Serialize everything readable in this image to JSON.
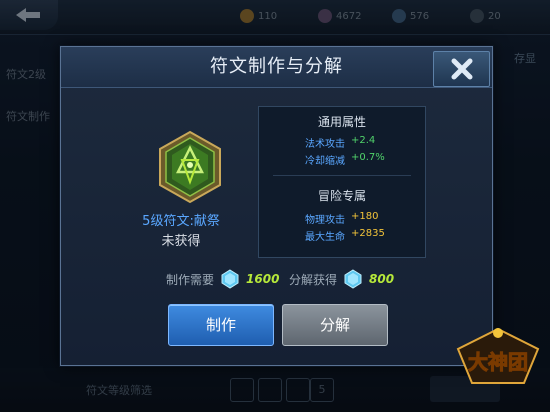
{
  "background": {
    "resources": [
      "110",
      "4672",
      "576",
      "20"
    ],
    "side_tabs": [
      "符文2级",
      "符文制作"
    ],
    "right_label": "存显",
    "bottom_filter_label": "符文等级筛选",
    "bottom_chip": "5"
  },
  "dialog": {
    "title": "符文制作与分解",
    "rune_name": "5级符文:献祭",
    "rune_status": "未获得",
    "general_attrs": {
      "title": "通用属性",
      "rows": [
        {
          "name": "法术攻击",
          "value": "+2.4"
        },
        {
          "name": "冷却缩减",
          "value": "+0.7%"
        }
      ]
    },
    "adventure_attrs": {
      "title": "冒险专属",
      "rows": [
        {
          "name": "物理攻击",
          "value": "+180"
        },
        {
          "name": "最大生命",
          "value": "+2835"
        }
      ]
    },
    "craft_cost_label": "制作需要",
    "craft_cost_value": "1600",
    "decompose_gain_label": "分解获得",
    "decompose_gain_value": "800",
    "craft_button": "制作",
    "decompose_button": "分解"
  },
  "logo_text": "大神团",
  "colors": {
    "accent_blue": "#5aa7ff",
    "value_green": "#50d26a",
    "value_yellow": "#f3c43a",
    "crystal_green": "#b6e83a"
  }
}
